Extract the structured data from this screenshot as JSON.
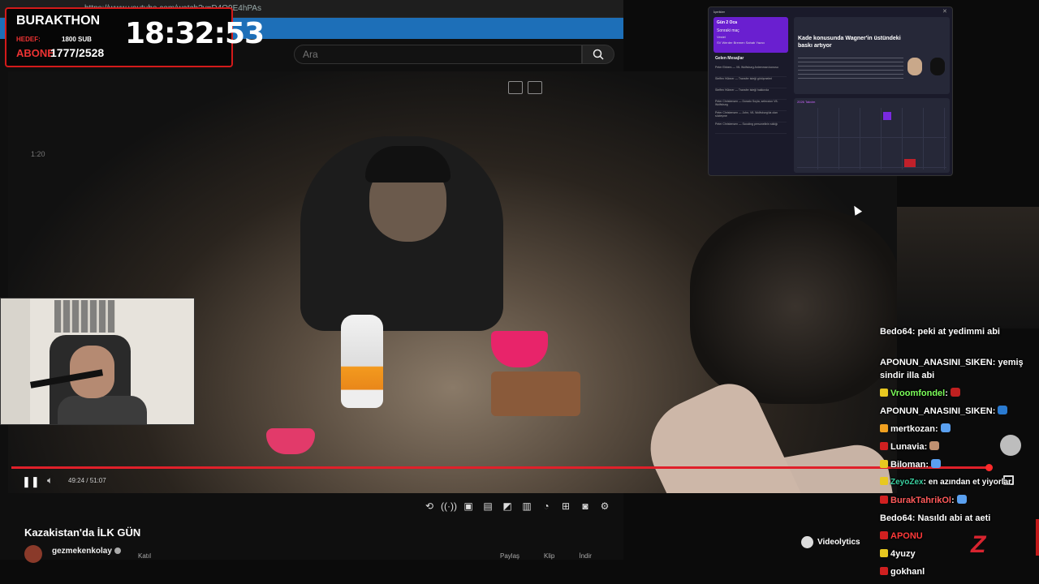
{
  "browser": {
    "url": "https://www.youtube.com/watch?v=D4Q9E4hPAs",
    "search_placeholder": "Ara",
    "small_time": "1:20"
  },
  "overlay": {
    "brand": "BURAKTHON",
    "target_label": "HEDEF:",
    "target_value": "1800 SUB",
    "sub_label": "ABONE",
    "sub_value": "1777/2528",
    "clock": "18:32:53"
  },
  "player": {
    "time": "49:24 / 51:07",
    "progress_fraction": 0.966
  },
  "video": {
    "title": "Kazakistan'da İLK GÜN",
    "channel": "gezmekenkolay",
    "actions": [
      "Katıl",
      "",
      "",
      "",
      "Paylaş",
      "Klip",
      "İndir"
    ]
  },
  "popup": {
    "header": "İçerikler",
    "card_title": "Gün 2 Oca",
    "card_sub": "Sonraki maç",
    "card_line1": "Vestel",
    "card_line2": "SV Werder Bremen Sahab Yazıcı",
    "messages_title": "Gelen Mesajlar",
    "messages": [
      "Peter Ebbers — VfL Wolfsburg Antrenman konusu",
      "Steffen Hübner — Transfer isteği görüşmeleri",
      "Steffen Hübner — Transfer isteği hakkında",
      "Peter Christensen — Dorado Soyla, seleccion VfL Wolfsburg",
      "Peter Christensen — John, VfL Wolfsburg'da olan sözleşme",
      "Peter Christensen — Scouting personelinin sıklığı"
    ],
    "news_title": "Kade konusunda Wagner'in üstündeki baskı artıyor",
    "calendar_label": "2026 Takvim"
  },
  "chat": [
    {
      "user": "Bedo64",
      "text": "peki at yedimmi abi",
      "color": "#ffffff",
      "badge": ""
    },
    {
      "user": "APONUN_ANASINI_SIKEN",
      "text": "yemiş",
      "color": "#ffffff",
      "badge": ""
    },
    {
      "user": "",
      "text": "sindir illa abi",
      "color": "#ffffff",
      "badge": ""
    },
    {
      "user": "Vroomfondel",
      "text": "",
      "color": "#7cff5a",
      "badge": "#e8c820",
      "emote": "#c02020"
    },
    {
      "user": "APONUN_ANASINI_SIKEN",
      "text": "",
      "color": "#ffffff",
      "badge": "",
      "emote": "#2a7ad0"
    },
    {
      "user": "mertkozan",
      "text": "",
      "color": "#ffffff",
      "badge": "#f0a020",
      "emote": "#5aa0f0"
    },
    {
      "user": "Lunavia",
      "text": "",
      "color": "#ffffff",
      "badge": "#d02020",
      "emote": "#c09070"
    },
    {
      "user": "Biloman",
      "text": "",
      "color": "#ffffff",
      "badge": "#e8c820",
      "emote": "#5aa0f0"
    },
    {
      "user": "ZeyoZex",
      "text": "en azından et yiyorlar",
      "color": "#3ad0a0",
      "badge": "#e8c820"
    },
    {
      "user": "BurakTahrikOl",
      "text": "",
      "color": "#ff5a5a",
      "badge": "#d02020",
      "emote": "#5aa0f0"
    },
    {
      "user": "Bedo64",
      "text": "Nasıldı abi at aeti",
      "color": "#ffffff",
      "badge": ""
    },
    {
      "user": "APONU",
      "text": "",
      "color": "#ff3a3a",
      "badge": "#d02020"
    },
    {
      "user": "4yuzy",
      "text": "",
      "color": "#ffffff",
      "badge": "#e8c820"
    },
    {
      "user": "gokhanl",
      "text": "",
      "color": "#ffffff",
      "badge": "#d02020"
    }
  ],
  "widgets": {
    "videolytics": "Videolytics",
    "brand_letter": "Z"
  },
  "colors": {
    "progress": "#e0202a",
    "overlay_border": "#d31a1a",
    "tab_strip": "#1d6fb8"
  }
}
